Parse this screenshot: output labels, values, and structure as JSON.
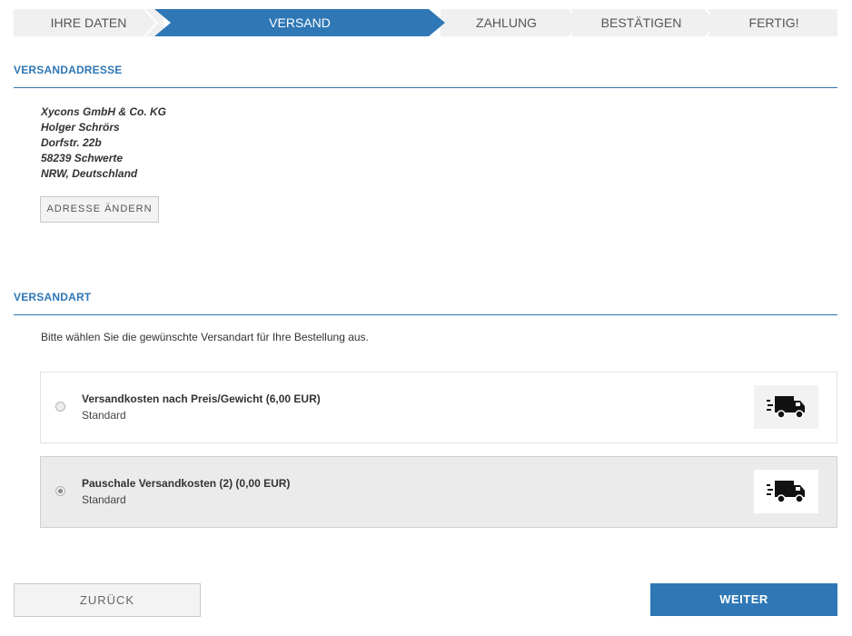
{
  "steps": [
    "IHRE DATEN",
    "VERSAND",
    "ZAHLUNG",
    "BESTÄTIGEN",
    "FERTIG!"
  ],
  "active_step": 1,
  "address_section": {
    "title": "VERSANDADRESSE",
    "lines": [
      "Xycons GmbH & Co. KG",
      "Holger Schrörs",
      "Dorfstr. 22b",
      "58239 Schwerte",
      "NRW, Deutschland"
    ],
    "change_button": "ADRESSE ÄNDERN"
  },
  "shipping_section": {
    "title": "VERSANDART",
    "intro": "Bitte wählen Sie die gewünschte Versandart für Ihre Bestellung aus.",
    "options": [
      {
        "title": "Versandkosten nach Preis/Gewicht (6,00 EUR)",
        "subtitle": "Standard",
        "selected": false,
        "icon": "truck-icon"
      },
      {
        "title": "Pauschale Versandkosten (2) (0,00 EUR)",
        "subtitle": "Standard",
        "selected": true,
        "icon": "truck-icon"
      }
    ]
  },
  "buttons": {
    "back": "ZURÜCK",
    "next": "WEITER"
  },
  "colors": {
    "accent": "#2f77b5",
    "step_bg": "#f0f0f0",
    "selected_bg": "#ebebeb"
  }
}
